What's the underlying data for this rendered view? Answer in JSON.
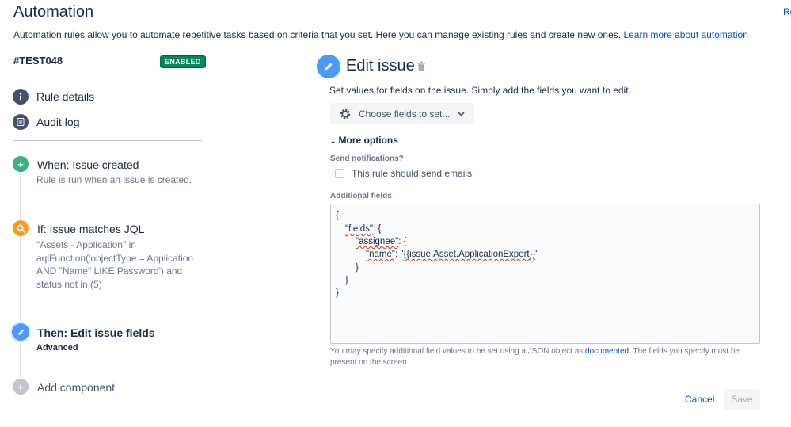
{
  "header": {
    "title": "Automation",
    "top_right_link": "Re",
    "intro_text": "Automation rules allow you to automate repetitive tasks based on criteria that you set. Here you can manage existing rules and create new ones.",
    "intro_link": "Learn more about automation"
  },
  "sidebar": {
    "rule_name": "#TEST048",
    "status_badge": "ENABLED",
    "links": [
      {
        "label": "Rule details",
        "icon": "info-icon"
      },
      {
        "label": "Audit log",
        "icon": "list-icon"
      }
    ],
    "steps": [
      {
        "title": "When: Issue created",
        "subtitle": "Rule is run when an issue is created.",
        "icon": "plus-icon",
        "color": "#36b37e"
      },
      {
        "title": "If: Issue matches JQL",
        "subtitle_lines": [
          "\"Assets - Application\" in",
          "aqlFunction('objectType = Application",
          "AND \"Name\" LIKE Password') and",
          "status not in (5)"
        ],
        "icon": "search-icon",
        "color": "#ff991f"
      },
      {
        "title": "Then: Edit issue fields",
        "subtitle": "Advanced",
        "icon": "pencil-icon",
        "color": "#4c9aff"
      },
      {
        "title": "Add component",
        "icon": "plus-icon",
        "color": "#c1c7d0"
      }
    ]
  },
  "editor": {
    "title": "Edit issue",
    "description": "Set values for fields on the issue. Simply add the fields you want to edit.",
    "choose_fields": "Choose fields to set...",
    "more_options": "More options",
    "send_notifications_label": "Send notifications?",
    "send_emails_checkbox": "This rule should send emails",
    "additional_fields_label": "Additional fields",
    "json": {
      "l1": "{",
      "l2_key": "\"fields\"",
      "l2_rest": ": {",
      "l3_key": "\"assignee\"",
      "l3_rest": ": {",
      "l4_key": "\"name\"",
      "l4_mid": ": \"",
      "l4_val": "{{issue.Asset.ApplicationExpert}}",
      "l4_end": "\"",
      "l5": "}",
      "l6": "}",
      "l7": "}"
    },
    "help_text_before": "You may specify additional field values to be set using a JSON object as",
    "help_link": "documented",
    "help_text_after": ". The fields you specify must be present on the screen.",
    "cancel": "Cancel",
    "save": "Save"
  },
  "colors": {
    "link": "#0052cc",
    "enabled_badge": "#00875a",
    "edit_icon": "#4c9aff"
  }
}
